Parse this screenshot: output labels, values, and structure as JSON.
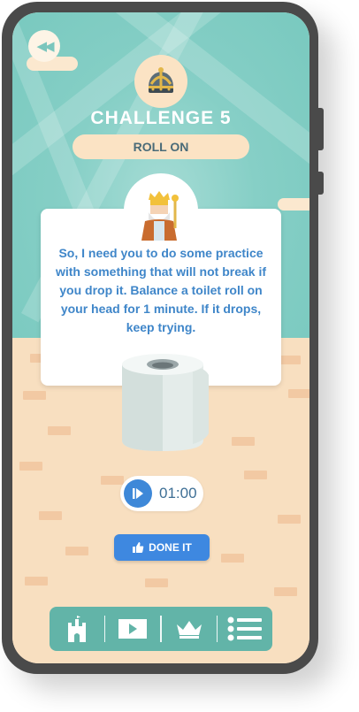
{
  "header": {
    "back_icon": "rewind-icon",
    "badge_icon": "crown-icon",
    "title": "CHALLENGE 5",
    "subtitle": "ROLL ON"
  },
  "dialog": {
    "avatar_icon": "king-icon",
    "text": "So, I need you to do some practice with something that will not break if you drop it. Balance a toilet roll on your head for 1 minute. If it drops, keep trying."
  },
  "timer": {
    "icon": "play-icon",
    "value": "01:00"
  },
  "done_button": {
    "icon": "thumbs-up-icon",
    "label": "DONE IT"
  },
  "nav": {
    "items": [
      {
        "icon": "castle-icon"
      },
      {
        "icon": "video-icon"
      },
      {
        "icon": "crown-icon"
      },
      {
        "icon": "list-icon"
      }
    ]
  },
  "colors": {
    "sky": "#79c9bf",
    "floor": "#f8dfc0",
    "accent_blue": "#3e88e0",
    "nav_bg": "#62b4a8",
    "text_blue": "#3f86c9"
  }
}
